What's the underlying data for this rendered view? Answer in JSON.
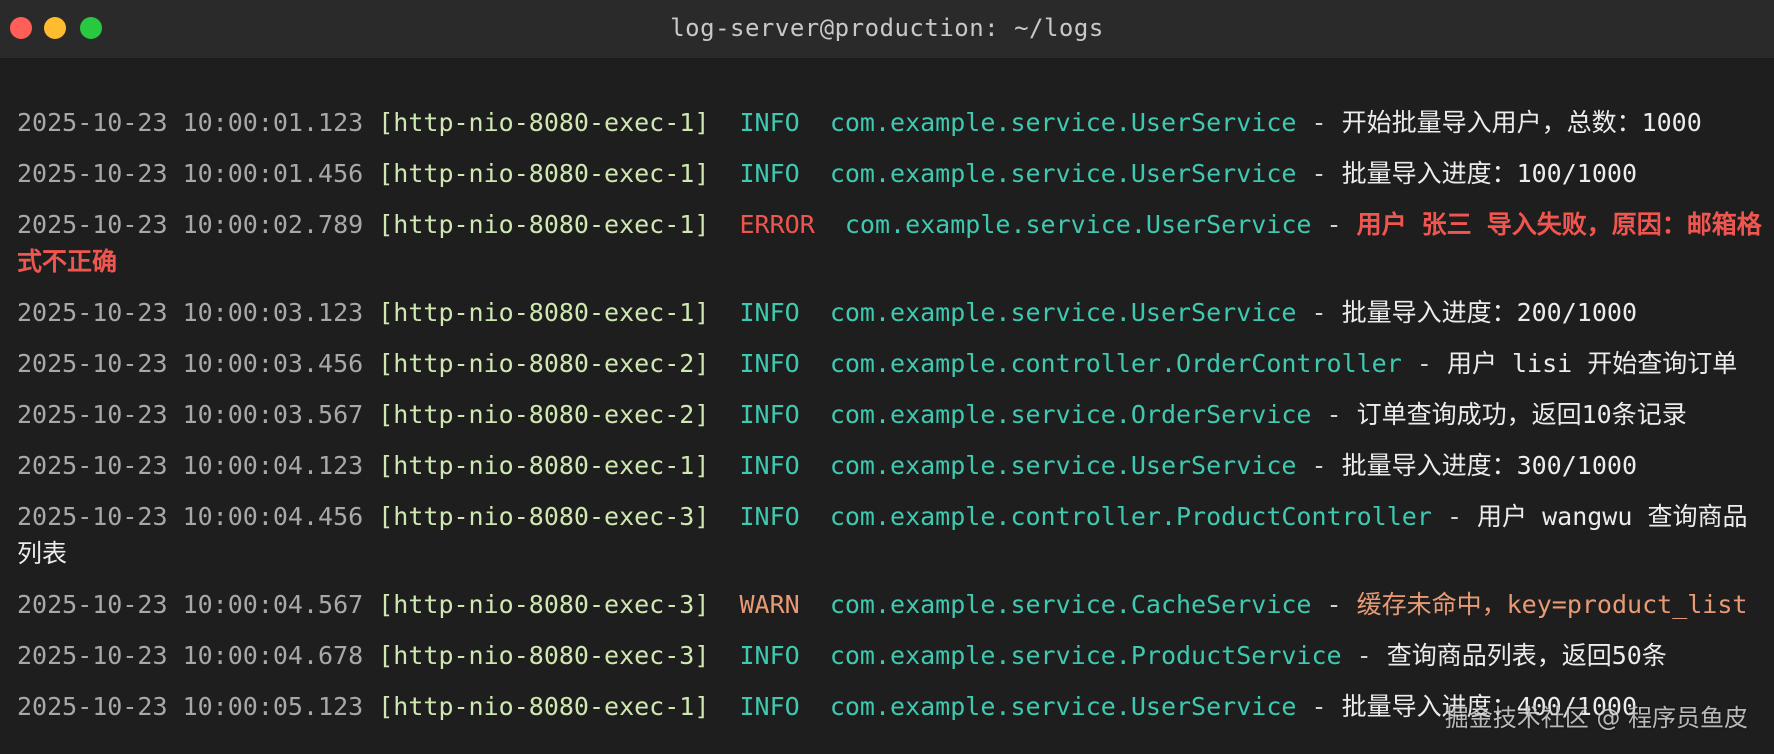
{
  "window": {
    "title": "log-server@production: ~/logs"
  },
  "colors": {
    "background": "#1e1e1e",
    "timestamp": "#a8a8a8",
    "thread": "#cfe7b0",
    "info": "#3ec9b0",
    "error": "#f0564f",
    "warn": "#e79a74",
    "message": "#ececec"
  },
  "logs": [
    {
      "timestamp": "2025-10-23 10:00:01.123",
      "thread": "[http-nio-8080-exec-1]",
      "level": "INFO",
      "logger": "com.example.service.UserService",
      "message": "开始批量导入用户，总数：1000"
    },
    {
      "timestamp": "2025-10-23 10:00:01.456",
      "thread": "[http-nio-8080-exec-1]",
      "level": "INFO",
      "logger": "com.example.service.UserService",
      "message": "批量导入进度：100/1000"
    },
    {
      "timestamp": "2025-10-23 10:00:02.789",
      "thread": "[http-nio-8080-exec-1]",
      "level": "ERROR",
      "logger": "com.example.service.UserService",
      "message": "用户 张三 导入失败，原因：邮箱格式不正确"
    },
    {
      "timestamp": "2025-10-23 10:00:03.123",
      "thread": "[http-nio-8080-exec-1]",
      "level": "INFO",
      "logger": "com.example.service.UserService",
      "message": "批量导入进度：200/1000"
    },
    {
      "timestamp": "2025-10-23 10:00:03.456",
      "thread": "[http-nio-8080-exec-2]",
      "level": "INFO",
      "logger": "com.example.controller.OrderController",
      "message": "用户 lisi 开始查询订单"
    },
    {
      "timestamp": "2025-10-23 10:00:03.567",
      "thread": "[http-nio-8080-exec-2]",
      "level": "INFO",
      "logger": "com.example.service.OrderService",
      "message": "订单查询成功，返回10条记录"
    },
    {
      "timestamp": "2025-10-23 10:00:04.123",
      "thread": "[http-nio-8080-exec-1]",
      "level": "INFO",
      "logger": "com.example.service.UserService",
      "message": "批量导入进度：300/1000"
    },
    {
      "timestamp": "2025-10-23 10:00:04.456",
      "thread": "[http-nio-8080-exec-3]",
      "level": "INFO",
      "logger": "com.example.controller.ProductController",
      "message": "用户 wangwu 查询商品列表"
    },
    {
      "timestamp": "2025-10-23 10:00:04.567",
      "thread": "[http-nio-8080-exec-3]",
      "level": "WARN",
      "logger": "com.example.service.CacheService",
      "message": "缓存未命中，key=product_list"
    },
    {
      "timestamp": "2025-10-23 10:00:04.678",
      "thread": "[http-nio-8080-exec-3]",
      "level": "INFO",
      "logger": "com.example.service.ProductService",
      "message": "查询商品列表，返回50条"
    },
    {
      "timestamp": "2025-10-23 10:00:05.123",
      "thread": "[http-nio-8080-exec-1]",
      "level": "INFO",
      "logger": "com.example.service.UserService",
      "message": "批量导入进度：400/1000"
    }
  ],
  "watermark": "掘金技术社区 @ 程序员鱼皮"
}
